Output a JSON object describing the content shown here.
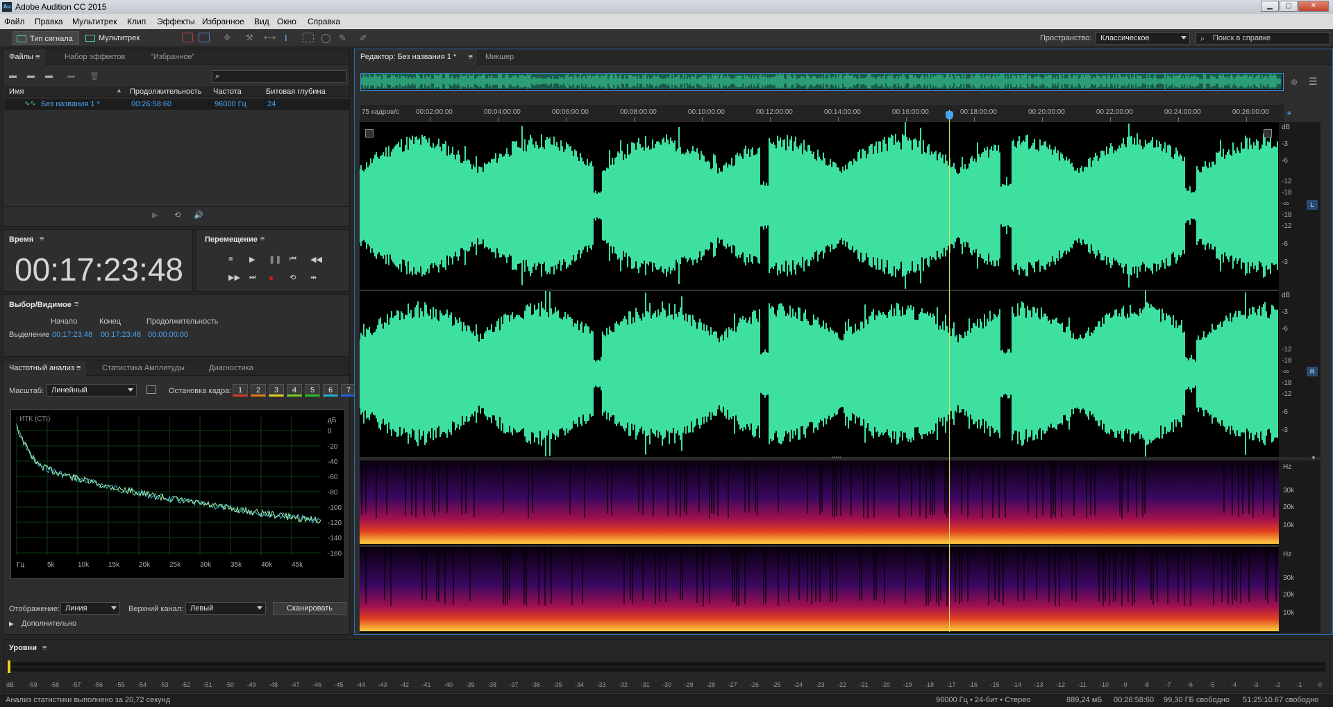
{
  "app": {
    "title": "Adobe Audition CC 2015",
    "logo": "Au"
  },
  "menu": [
    "Файл",
    "Правка",
    "Мультитрек",
    "Клип",
    "Эффекты",
    "Избранное",
    "Вид",
    "Окно",
    "Справка"
  ],
  "toolbar": {
    "waveform_label": "Тип сигнала",
    "multitrack_label": "Мультитрек",
    "workspace_label": "Пространство:",
    "workspace_value": "Классическое",
    "help_search_placeholder": "Поиск в справке"
  },
  "files_panel": {
    "tabs": [
      "Файлы",
      "Набор эффектов",
      "\"Избранное\""
    ],
    "columns": [
      "Имя",
      "Продолжительность",
      "Частота",
      "Битовая глубина"
    ],
    "rows": [
      {
        "name": "Без названия 1 *",
        "duration": "00:26:58:60",
        "rate": "96000 Гц",
        "depth": "24"
      }
    ]
  },
  "time_panel": {
    "title": "Время",
    "value": "00:17:23:48"
  },
  "transport_panel": {
    "title": "Перемещение"
  },
  "selection_panel": {
    "title": "Выбор/Видимое",
    "headers": [
      "Начало",
      "Конец",
      "Продолжительность"
    ],
    "row_label": "Выделение",
    "start": "00:17:23:48",
    "end": "00:17:23:48",
    "duration": "00:00:00:00"
  },
  "freq_panel": {
    "tabs": [
      "Частотный анализ",
      "Статистика Амплитуды",
      "Диагностика"
    ],
    "scale_label": "Масштаб:",
    "scale_value": "Линейный",
    "hold_label": "Остановка кадра:",
    "hold_buttons": [
      "1",
      "2",
      "3",
      "4",
      "5",
      "6",
      "7"
    ],
    "hold_colors": [
      "#d23a2a",
      "#e07a1a",
      "#e0d020",
      "#7ad020",
      "#20c020",
      "#20b0d0",
      "#2060e0"
    ],
    "graph_title": "ИТК (СТI)",
    "db_label": "дБ",
    "db_ticks": [
      "0",
      "-20",
      "-40",
      "-60",
      "-80",
      "-100",
      "-120",
      "-140",
      "-160"
    ],
    "hz_ticks": [
      "Гц",
      "5k",
      "10k",
      "15k",
      "20k",
      "25k",
      "30k",
      "35k",
      "40k",
      "45k"
    ],
    "display_label": "Отображение:",
    "display_value": "Линия",
    "channel_label": "Верхний канал:",
    "channel_value": "Левый",
    "scan_button": "Сканировать",
    "advanced_label": "Дополнительно"
  },
  "editor": {
    "tabs": [
      "Редактор: Без названия 1 *",
      "Микшер"
    ],
    "fps_label": "75 кадров/с",
    "ruler": [
      "00:02:00:00",
      "00:04:00:00",
      "00:06:00:00",
      "00:08:00:00",
      "00:10:00:00",
      "00:12:00:00",
      "00:14:00:00",
      "00:16:00:00",
      "00:18:00:00",
      "00:20:00:00",
      "00:22:00:00",
      "00:24:00:00",
      "00:26:00:00"
    ],
    "db_scale": [
      "dB",
      "-3",
      "-6",
      "-12",
      "-18",
      "-∞",
      "-18",
      "-12",
      "-6",
      "-3"
    ],
    "hz_scale": [
      "Hz",
      "30k",
      "20k",
      "10k"
    ],
    "channels": [
      "L",
      "R"
    ],
    "wave_color": "#3ee0a0",
    "playhead_fraction": 0.64
  },
  "levels": {
    "title": "Уровни",
    "ticks": [
      "dB",
      "-59",
      "-58",
      "-57",
      "-56",
      "-55",
      "-54",
      "-53",
      "-52",
      "-51",
      "-50",
      "-49",
      "-48",
      "-47",
      "-46",
      "-45",
      "-44",
      "-43",
      "-42",
      "-41",
      "-40",
      "-39",
      "-38",
      "-37",
      "-36",
      "-35",
      "-34",
      "-33",
      "-32",
      "-31",
      "-30",
      "-29",
      "-28",
      "-27",
      "-26",
      "-25",
      "-24",
      "-23",
      "-22",
      "-21",
      "-20",
      "-19",
      "-18",
      "-17",
      "-16",
      "-15",
      "-14",
      "-13",
      "-12",
      "-11",
      "-10",
      "-9",
      "-8",
      "-7",
      "-6",
      "-5",
      "-4",
      "-3",
      "-2",
      "-1",
      "0"
    ]
  },
  "status": {
    "message": "Анализ статистики выполнено за 20,72 секунд",
    "format": "96000 Гц • 24-бит • Стерео",
    "size": "889,24 мБ",
    "duration": "00:26:58:60",
    "free": "99,30 ГБ свободно",
    "free_time": "51:25:10.67 свободно"
  }
}
